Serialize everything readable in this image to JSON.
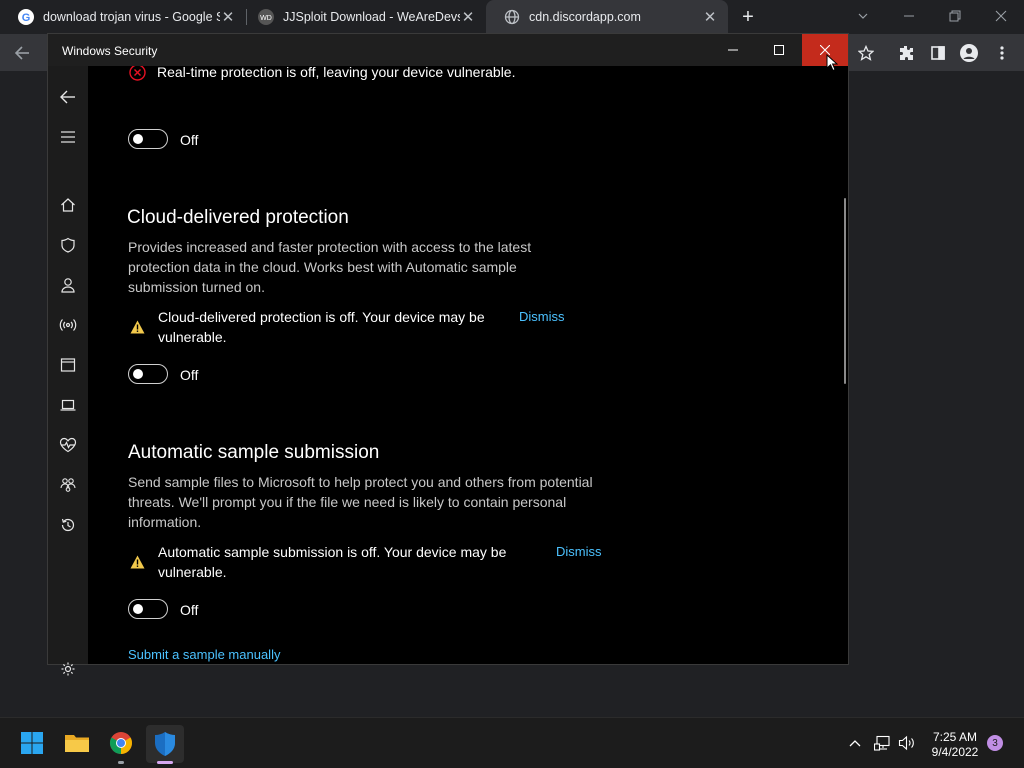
{
  "browser": {
    "tabs": [
      {
        "title": "download trojan virus - Google S",
        "icon": "google-icon",
        "active": false
      },
      {
        "title": "JJSploit Download - WeAreDevs",
        "icon": "wearedevs-icon",
        "active": false
      },
      {
        "title": "cdn.discordapp.com",
        "icon": "globe-icon",
        "active": true
      }
    ],
    "new_tab": "+"
  },
  "window": {
    "title": "Windows Security"
  },
  "sections": {
    "realtime": {
      "status": "Real-time protection is off, leaving your device vulnerable.",
      "toggle_label": "Off"
    },
    "cloud": {
      "heading": "Cloud-delivered protection",
      "description": "Provides increased and faster protection with access to the latest protection data in the cloud. Works best with Automatic sample submission turned on.",
      "warning": "Cloud-delivered protection is off. Your device may be vulnerable.",
      "dismiss": "Dismiss",
      "toggle_label": "Off"
    },
    "sample": {
      "heading": "Automatic sample submission",
      "description": "Send sample files to Microsoft to help protect you and others from potential threats. We'll prompt you if the file we need is likely to contain personal information.",
      "warning": "Automatic sample submission is off. Your device may be vulnerable.",
      "dismiss": "Dismiss",
      "toggle_label": "Off"
    },
    "manual_link": "Submit a sample manually"
  },
  "taskbar": {
    "time": "7:25 AM",
    "date": "9/4/2022",
    "notification_count": "3"
  },
  "colors": {
    "accent_link": "#4cc2ff",
    "close_red": "#c42b1c",
    "warning_yellow": "#f2c94c",
    "error_red": "#e81123"
  }
}
